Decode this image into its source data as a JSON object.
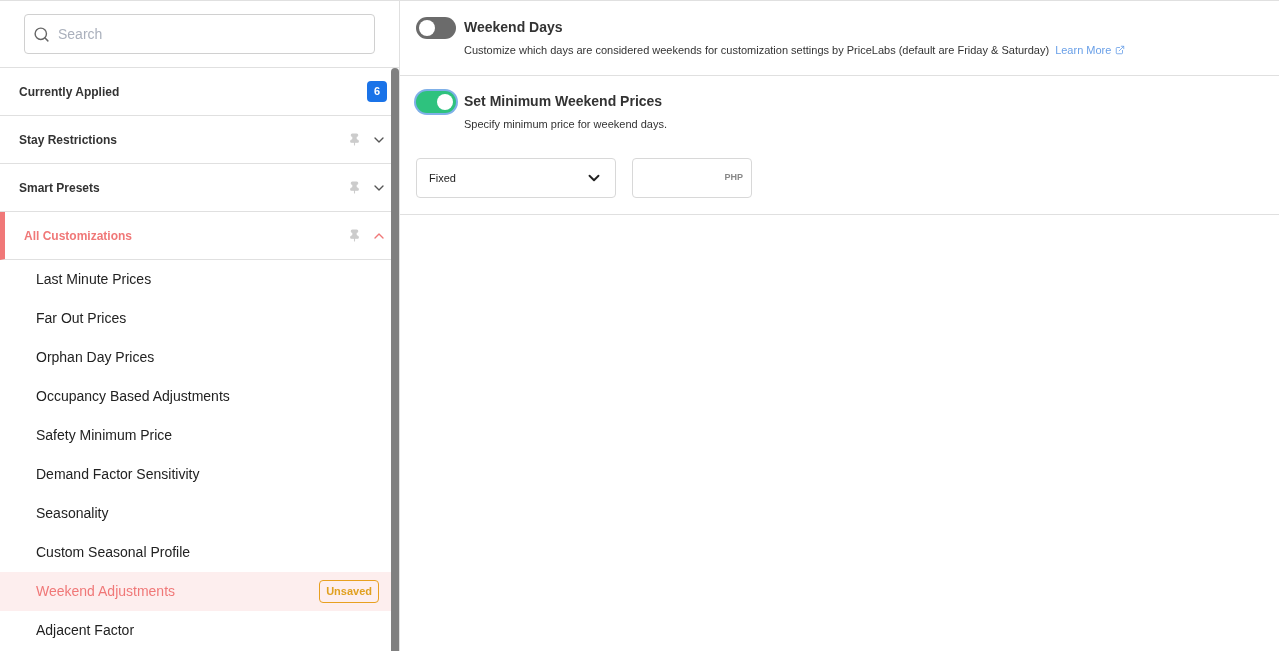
{
  "search": {
    "placeholder": "Search"
  },
  "sections": [
    {
      "kind": "count",
      "label": "Currently Applied",
      "count": "6",
      "selected": false
    },
    {
      "kind": "group",
      "label": "Stay Restrictions",
      "expanded": false,
      "selected": false
    },
    {
      "kind": "group",
      "label": "Smart Presets",
      "expanded": false,
      "selected": false
    },
    {
      "kind": "group",
      "label": "All Customizations",
      "expanded": true,
      "selected": true
    }
  ],
  "items": [
    {
      "label": "Last Minute Prices",
      "selected": false
    },
    {
      "label": "Far Out Prices",
      "selected": false
    },
    {
      "label": "Orphan Day Prices",
      "selected": false
    },
    {
      "label": "Occupancy Based Adjustments",
      "selected": false
    },
    {
      "label": "Safety Minimum Price",
      "selected": false
    },
    {
      "label": "Demand Factor Sensitivity",
      "selected": false
    },
    {
      "label": "Seasonality",
      "selected": false
    },
    {
      "label": "Custom Seasonal Profile",
      "selected": false
    },
    {
      "label": "Weekend Adjustments",
      "selected": true,
      "badge": "Unsaved"
    },
    {
      "label": "Adjacent Factor",
      "selected": false
    }
  ],
  "settings": [
    {
      "title": "Weekend Days",
      "on": false,
      "description": "Customize which days are considered weekends for customization settings by PriceLabs (default are Friday & Saturday)",
      "link": "Learn More"
    },
    {
      "title": "Set Minimum Weekend Prices",
      "on": true,
      "focused": true,
      "description": "Specify minimum price for weekend days.",
      "select": "Fixed",
      "unit": "PHP"
    }
  ]
}
